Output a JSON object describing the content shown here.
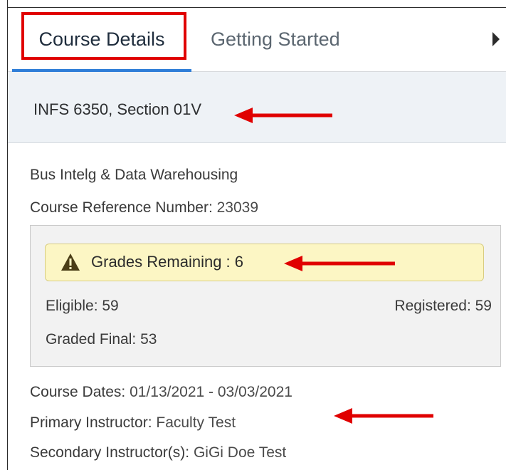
{
  "tabs": [
    {
      "label": "Course Details",
      "active": true
    },
    {
      "label": "Getting Started",
      "active": false
    }
  ],
  "section": {
    "title": "INFS 6350, Section 01V"
  },
  "course": {
    "name": "Bus Intelg & Data Warehousing",
    "crn_label": "Course Reference Number:",
    "crn_value": "23039"
  },
  "grades": {
    "remaining_text": "Grades Remaining : 6",
    "eligible": "Eligible: 59",
    "registered": "Registered: 59",
    "graded_final": "Graded Final: 53"
  },
  "details": {
    "dates_label": "Course Dates:",
    "dates_value": "01/13/2021 - 03/03/2021",
    "primary_label": "Primary Instructor:",
    "primary_value": "Faculty Test",
    "secondary_label": "Secondary Instructor(s):",
    "secondary_value": "GiGi Doe Test"
  },
  "icons": {
    "tab_scroll": "caret-right-icon",
    "warning": "warning-triangle-icon",
    "annotation": "red-arrow-icon"
  },
  "colors": {
    "active_tab_underline": "#2f7ed8",
    "annotation_red": "#e00000",
    "warning_bg": "#fcf6c4",
    "header_bg": "#eef2f6"
  }
}
